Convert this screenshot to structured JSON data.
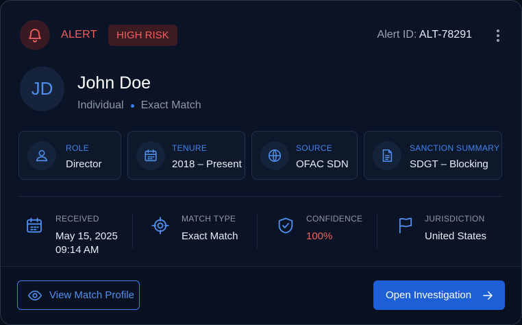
{
  "header": {
    "alert_label": "ALERT",
    "risk_badge": "HIGH RISK",
    "alert_id_label": "Alert ID:",
    "alert_id_value": "ALT-78291"
  },
  "subject": {
    "initials": "JD",
    "name": "John Doe",
    "entity_type": "Individual",
    "match_status": "Exact Match"
  },
  "tiles": [
    {
      "label": "ROLE",
      "value": "Director",
      "icon": "user-icon"
    },
    {
      "label": "TENURE",
      "value": "2018 – Present",
      "icon": "calendar-icon"
    },
    {
      "label": "SOURCE",
      "value": "OFAC SDN",
      "icon": "globe-icon"
    },
    {
      "label": "SANCTION SUMMARY",
      "value": "SDGT – Blocking",
      "icon": "document-icon"
    }
  ],
  "stats": {
    "received": {
      "label": "RECEIVED",
      "date": "May 15, 2025",
      "time": "09:14 AM",
      "icon": "calendar-icon"
    },
    "match_type": {
      "label": "MATCH TYPE",
      "value": "Exact Match",
      "icon": "target-icon"
    },
    "confidence": {
      "label": "CONFIDENCE",
      "value": "100%",
      "icon": "shield-check-icon"
    },
    "jurisdiction": {
      "label": "JURISDICTION",
      "value": "United States",
      "icon": "flag-icon"
    }
  },
  "actions": {
    "view_profile": "View Match Profile",
    "open_investigation": "Open Investigation"
  },
  "colors": {
    "alert_red": "#f0605d",
    "accent_blue": "#3f84ef",
    "primary_button": "#1d5fd6",
    "card_bg": "#0b1426"
  }
}
